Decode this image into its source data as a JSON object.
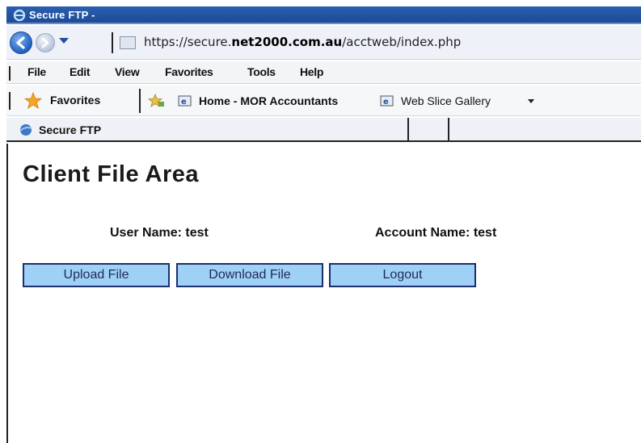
{
  "window": {
    "title": "Secure FTP -"
  },
  "address_bar": {
    "url_prefix": "https://secure.",
    "url_domain": "net2000.com.au",
    "url_path": "/acctweb/index.php"
  },
  "menu": {
    "items": [
      "File",
      "Edit",
      "View",
      "Favorites",
      "Tools",
      "Help"
    ]
  },
  "favorites_bar": {
    "favorites_label": "Favorites",
    "links": [
      "Home - MOR Accountants",
      "Web Slice Gallery"
    ]
  },
  "tab": {
    "label": "Secure FTP"
  },
  "page": {
    "title": "Client File Area",
    "user_name_label": "User Name:",
    "user_name_value": "test",
    "account_name_label": "Account Name:",
    "account_name_value": "test",
    "buttons": {
      "upload": "Upload File",
      "download": "Download File",
      "logout": "Logout"
    }
  },
  "colors": {
    "titlebar": "#1c4a98",
    "button_fill": "#9fd0f5",
    "button_border": "#1c2f6e"
  }
}
